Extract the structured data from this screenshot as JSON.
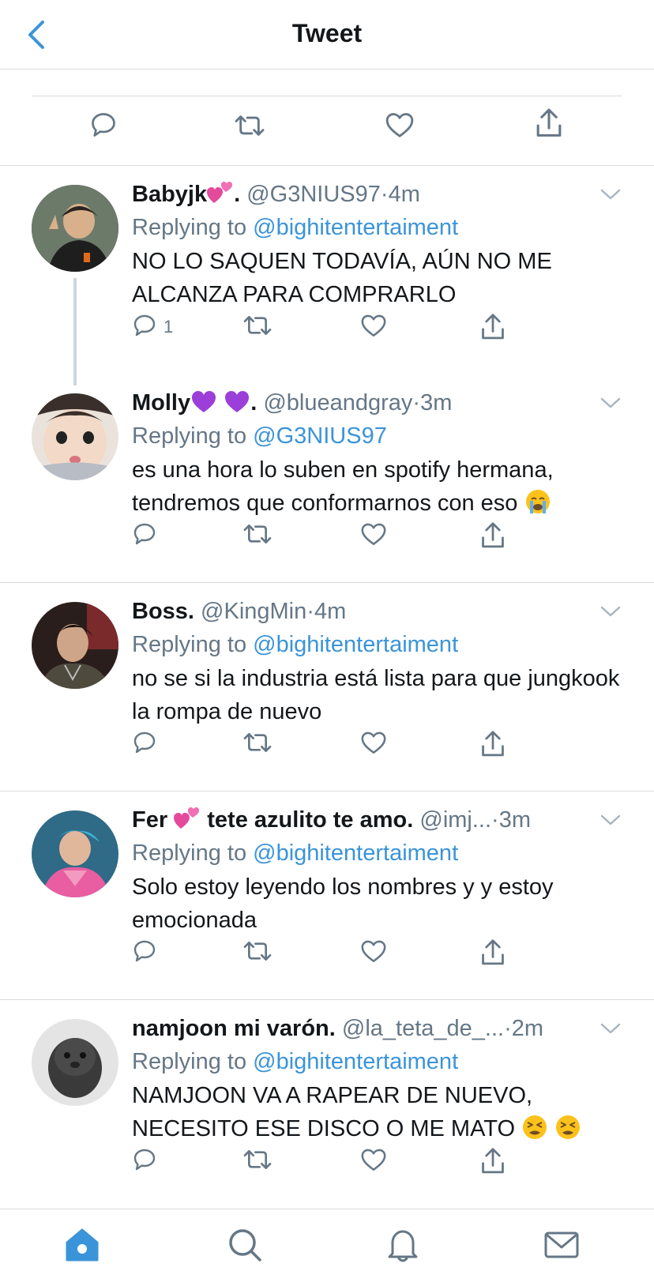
{
  "header": {
    "title": "Tweet"
  },
  "colors": {
    "accent": "#3b94d9",
    "secondary_text": "#657786",
    "divider": "#d7dbdf"
  },
  "tweets": [
    {
      "name": "Babyjk",
      "name_suffix": ".",
      "emojis_after_name": [
        "pink-hearts"
      ],
      "handle": "@G3NIUS97",
      "time": "4m",
      "replying_prefix": "Replying to",
      "replying_to": "@bighitentertaiment",
      "text": "NO LO SAQUEN TODAVÍA, AÚN NO ME ALCANZA PARA COMPRARLO",
      "reply_count": "1"
    },
    {
      "name": "Molly",
      "name_suffix": ".",
      "emojis_after_name": [
        "purple-heart",
        "purple-heart"
      ],
      "handle": "@blueandgray",
      "time": "3m",
      "replying_prefix": "Replying to",
      "replying_to": "@G3NIUS97",
      "text": "es una hora lo suben en spotify hermana, tendremos que conformarnos con eso",
      "text_emoji": "crying-face",
      "reply_count": ""
    },
    {
      "name": "Boss.",
      "handle": "@KingMin",
      "time": "4m",
      "replying_prefix": "Replying to",
      "replying_to": "@bighitentertaiment",
      "text": "no se si la industria está lista para que jungkook la rompa de nuevo",
      "reply_count": ""
    },
    {
      "name": "Fer",
      "name_tail": "tete azulito te amo.",
      "emojis_after_name": [
        "pink-hearts"
      ],
      "handle": "@imj...",
      "time": "3m",
      "replying_prefix": "Replying to",
      "replying_to": "@bighitentertaiment",
      "text": "Solo estoy leyendo los nombres y y estoy emocionada",
      "reply_count": ""
    },
    {
      "name": "namjoon mi varón.",
      "handle": "@la_teta_de_...",
      "time": "2m",
      "replying_prefix": "Replying to",
      "replying_to": "@bighitentertaiment",
      "text": "NAMJOON VA A RAPEAR DE NUEVO, NECESITO ESE DISCO O ME MATO",
      "text_emoji": "tired-face x2",
      "reply_count": ""
    }
  ],
  "dot": "·"
}
